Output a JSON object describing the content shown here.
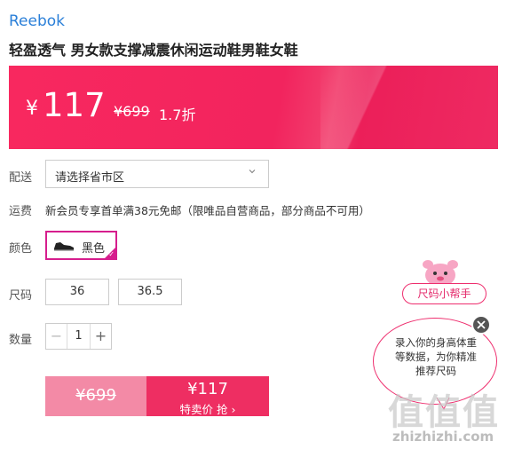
{
  "brand": "Reebok",
  "title": "轻盈透气 男女款支撑减震休闲运动鞋男鞋女鞋",
  "price": {
    "currency": "¥",
    "current": "117",
    "original": "¥699",
    "discount": "1.7折"
  },
  "labels": {
    "delivery": "配送",
    "shipping": "运费",
    "color": "颜色",
    "size": "尺码",
    "quantity": "数量"
  },
  "delivery_select": {
    "value": "请选择省市区"
  },
  "shipping_text": "新会员专享首单满38元免邮（限唯品自营商品，部分商品不可用）",
  "color_option": {
    "label": "黑色",
    "selected": true
  },
  "sizes": [
    "36",
    "36.5"
  ],
  "quantity": {
    "value": "1",
    "minus": "−",
    "plus": "+"
  },
  "buy": {
    "original": "¥699",
    "price": "¥117",
    "action": "特卖价 抢 ›"
  },
  "size_helper": {
    "button": "尺码小帮手",
    "bubble_text": "录入你的身高体重等数据，为你精准推荐尺码"
  },
  "watermark": {
    "logo": "值值值",
    "url": "zhizhizhi.com"
  },
  "colors": {
    "accent": "#ee2e62",
    "brand_link": "#2a7fd8",
    "selected_border": "#d61e8d"
  }
}
